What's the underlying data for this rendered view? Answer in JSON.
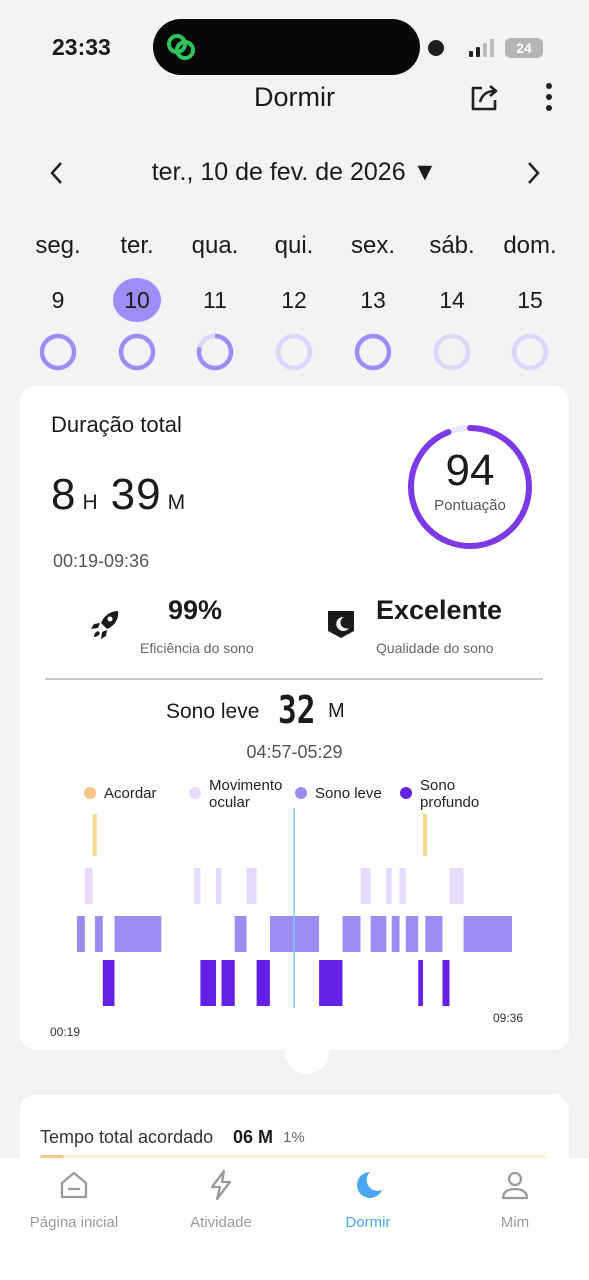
{
  "status_bar": {
    "time": "23:33",
    "battery": "24"
  },
  "header": {
    "title": "Dormir"
  },
  "date_nav": {
    "date": "ter., 10 de fev. de 2026 ▼"
  },
  "week": {
    "weekdays": [
      "seg.",
      "ter.",
      "qua.",
      "qui.",
      "sex.",
      "sáb.",
      "dom."
    ],
    "days": [
      "9",
      "10",
      "11",
      "12",
      "13",
      "14",
      "15"
    ],
    "selected_index": 1
  },
  "summary": {
    "duration_label": "Duração total",
    "hours": "8",
    "hours_unit": "H",
    "minutes": "39",
    "minutes_unit": "M",
    "time_range": "00:19-09:36",
    "score": "94",
    "score_label": "Pontuação",
    "score_fraction": 0.94,
    "efficiency_value": "99%",
    "efficiency_label": "Eficiência do sono",
    "quality_value": "Excelente",
    "quality_label": "Qualidade do sono"
  },
  "stage_detail": {
    "label": "Sono leve",
    "value": "32",
    "unit": "M",
    "range": "04:57-05:29"
  },
  "legend": {
    "awake": "Acordar",
    "rem_line1": "Movimento",
    "rem_line2": "ocular",
    "light": "Sono leve",
    "deep_line1": "Sono",
    "deep_line2": "profundo"
  },
  "colors": {
    "awake": "#f4d98a",
    "rem": "#e6dcfa",
    "light": "#9b8cf0",
    "deep": "#6420e6",
    "accent": "#7c3ae6",
    "nav_active": "#4aa6f3"
  },
  "chart_data": {
    "type": "hypnogram",
    "start": "00:19",
    "end": "09:36",
    "stages": [
      "Acordar",
      "Movimento ocular",
      "Sono leve",
      "Sono profundo"
    ],
    "segments": [
      {
        "stage": "Sono leve",
        "from": "00:19",
        "to": "00:29"
      },
      {
        "stage": "Movimento ocular",
        "from": "00:29",
        "to": "00:39"
      },
      {
        "stage": "Acordar",
        "from": "00:39",
        "to": "00:42"
      },
      {
        "stage": "Sono leve",
        "from": "00:42",
        "to": "00:52"
      },
      {
        "stage": "Sono profundo",
        "from": "00:52",
        "to": "01:07"
      },
      {
        "stage": "Sono leve",
        "from": "01:07",
        "to": "02:07"
      },
      {
        "stage": "Movimento ocular",
        "from": "02:49",
        "to": "02:57"
      },
      {
        "stage": "Sono profundo",
        "from": "02:57",
        "to": "03:17"
      },
      {
        "stage": "Movimento ocular",
        "from": "03:17",
        "to": "03:24"
      },
      {
        "stage": "Sono profundo",
        "from": "03:24",
        "to": "03:41"
      },
      {
        "stage": "Sono leve",
        "from": "03:41",
        "to": "03:56"
      },
      {
        "stage": "Movimento ocular",
        "from": "03:56",
        "to": "04:09"
      },
      {
        "stage": "Sono profundo",
        "from": "04:09",
        "to": "04:26"
      },
      {
        "stage": "Sono leve",
        "from": "04:26",
        "to": "04:57"
      },
      {
        "stage": "Sono leve",
        "from": "04:57",
        "to": "05:29"
      },
      {
        "stage": "Sono profundo",
        "from": "05:29",
        "to": "05:59"
      },
      {
        "stage": "Sono leve",
        "from": "05:59",
        "to": "06:22"
      },
      {
        "stage": "Movimento ocular",
        "from": "06:22",
        "to": "06:35"
      },
      {
        "stage": "Sono leve",
        "from": "06:35",
        "to": "06:55"
      },
      {
        "stage": "Movimento ocular",
        "from": "06:55",
        "to": "07:02"
      },
      {
        "stage": "Sono leve",
        "from": "07:02",
        "to": "07:12"
      },
      {
        "stage": "Movimento ocular",
        "from": "07:12",
        "to": "07:20"
      },
      {
        "stage": "Sono leve",
        "from": "07:20",
        "to": "07:36"
      },
      {
        "stage": "Sono profundo",
        "from": "07:36",
        "to": "07:42"
      },
      {
        "stage": "Acordar",
        "from": "07:42",
        "to": "07:45"
      },
      {
        "stage": "Sono leve",
        "from": "07:45",
        "to": "08:07"
      },
      {
        "stage": "Sono profundo",
        "from": "08:07",
        "to": "08:16"
      },
      {
        "stage": "Movimento ocular",
        "from": "08:16",
        "to": "08:34"
      },
      {
        "stage": "Sono leve",
        "from": "08:34",
        "to": "09:36"
      }
    ],
    "highlight": {
      "from": "04:57",
      "to": "05:29"
    }
  },
  "awake_summary": {
    "label": "Tempo total acordado",
    "value": "06 M",
    "percent": "1%",
    "fraction": 0.01
  },
  "bottom_nav": {
    "home": "Página inicial",
    "activity": "Atividade",
    "sleep": "Dormir",
    "me": "Mim"
  }
}
